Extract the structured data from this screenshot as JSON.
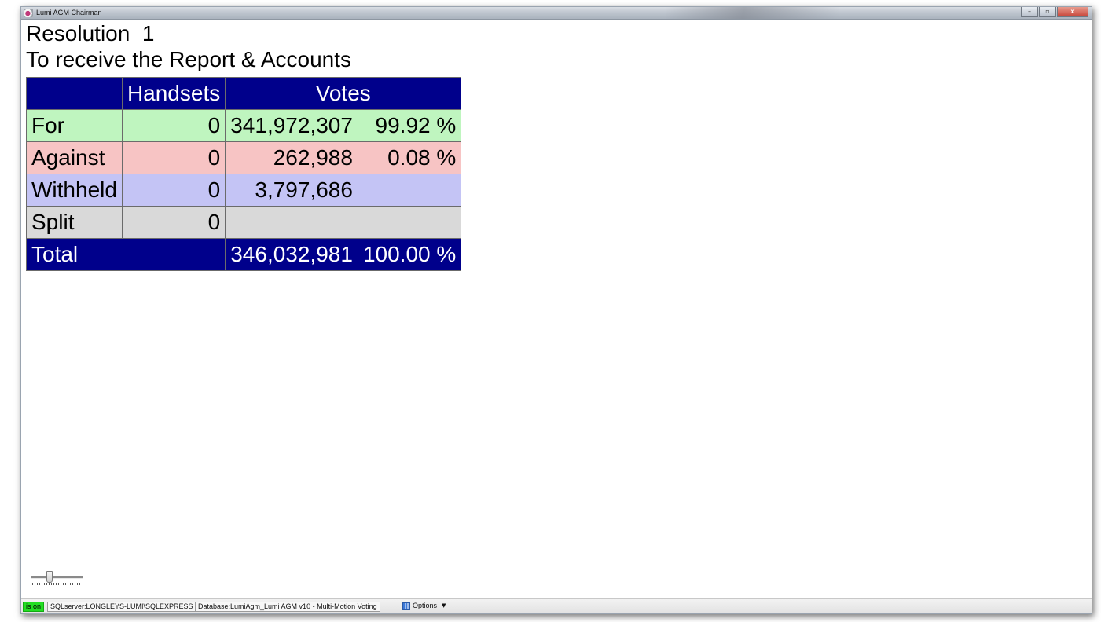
{
  "window": {
    "title": "Lumi AGM Chairman",
    "minimize": "–",
    "maximize": "▫",
    "close": "x"
  },
  "resolution": {
    "title": "Resolution  1",
    "description": "To receive the Report & Accounts"
  },
  "table": {
    "headers": {
      "blank": "",
      "handsets": "Handsets",
      "votes": "Votes"
    },
    "rows": {
      "for": {
        "label": "For",
        "handsets": "0",
        "votes": "341,972,307",
        "percent": "99.92 %"
      },
      "against": {
        "label": "Against",
        "handsets": "0",
        "votes": "262,988",
        "percent": "0.08 %"
      },
      "withheld": {
        "label": "Withheld",
        "handsets": "0",
        "votes": "3,797,686",
        "percent": ""
      },
      "split": {
        "label": "Split",
        "handsets": "0",
        "votes": ""
      },
      "total": {
        "label": "Total",
        "votes": "346,032,981",
        "percent": "100.00 %"
      }
    },
    "colors": {
      "header": "#00008b",
      "for": "#bff5bf",
      "against": "#f7c4c4",
      "withheld": "#c4c4f5",
      "split": "#d9d9d9"
    }
  },
  "slider": {
    "value_fraction": 0.35
  },
  "statusbar": {
    "status": "is on",
    "server": "SQLserver:LONGLEYS-LUMI\\SQLEXPRESS",
    "database": "Database:LumiAgm_Lumi AGM v10 - Multi-Motion Voting",
    "options": "Options",
    "options_caret": "▼",
    "status_color": "#22dd22"
  }
}
